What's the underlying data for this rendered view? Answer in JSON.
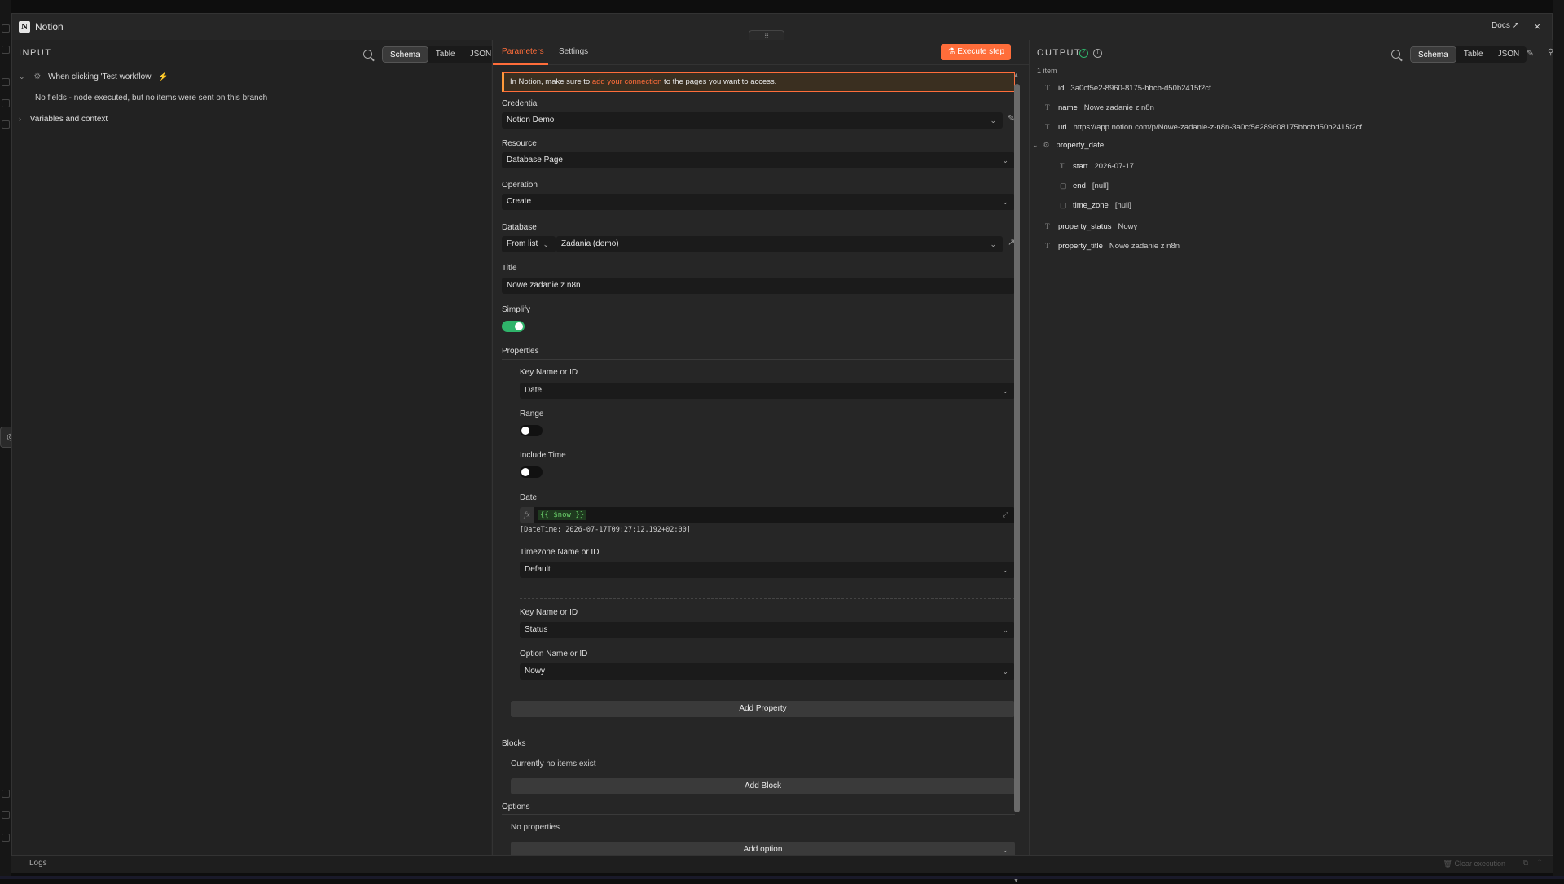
{
  "window": {
    "title": "Notion",
    "docs_label": "Docs ↗",
    "close_glyph": "×",
    "drag_glyph": "⠿"
  },
  "input": {
    "header": "INPUT",
    "view_tabs": [
      "Schema",
      "Table",
      "JSON"
    ],
    "trigger_label": "When clicking 'Test workflow'",
    "trigger_badge": "⚡",
    "no_fields_text": "No fields - node executed, but no items were sent on this branch",
    "variables_label": "Variables and context"
  },
  "params": {
    "tabs": [
      "Parameters",
      "Settings"
    ],
    "execute_label": "Execute step",
    "notice": {
      "prefix": "In Notion, make sure to ",
      "link": "add your connection",
      "suffix": " to the pages you want to access."
    },
    "credential": {
      "label": "Credential",
      "value": "Notion Demo"
    },
    "resource": {
      "label": "Resource",
      "value": "Database Page"
    },
    "operation": {
      "label": "Operation",
      "value": "Create"
    },
    "database": {
      "label": "Database",
      "mode": "From list",
      "value": "Zadania (demo)"
    },
    "title": {
      "label": "Title",
      "value": "Nowe zadanie z n8n"
    },
    "simplify": {
      "label": "Simplify",
      "on": true
    },
    "properties_label": "Properties",
    "property1": {
      "key_label": "Key Name or ID",
      "key_value": "Date",
      "range_label": "Range",
      "range_on": false,
      "include_time_label": "Include Time",
      "include_time_on": false,
      "date_label": "Date",
      "date_expr": "{{ $now }}",
      "fx": "fx",
      "date_hint": "[DateTime: 2026-07-17T09:27:12.192+02:00]",
      "tz_label": "Timezone Name or ID",
      "tz_value": "Default"
    },
    "property2": {
      "key_label": "Key Name or ID",
      "key_value": "Status",
      "option_label": "Option Name or ID",
      "option_value": "Nowy"
    },
    "add_property": "Add Property",
    "blocks": {
      "label": "Blocks",
      "empty": "Currently no items exist",
      "add": "Add Block"
    },
    "options": {
      "label": "Options",
      "empty": "No properties",
      "add": "Add option"
    }
  },
  "output": {
    "header": "OUTPUT",
    "count": "1 item",
    "view_tabs": [
      "Schema",
      "Table",
      "JSON"
    ],
    "fields": [
      {
        "type": "T",
        "key": "id",
        "value": "3a0cf5e2-8960-8175-bbcb-d50b2415f2cf"
      },
      {
        "type": "T",
        "key": "name",
        "value": "Nowe zadanie z n8n"
      },
      {
        "type": "T",
        "key": "url",
        "value": "https://app.notion.com/p/Nowe-zadanie-z-n8n-3a0cf5e289608175bbcbd50b2415f2cf"
      },
      {
        "type": "⚙",
        "key": "property_date",
        "value": ""
      },
      {
        "type": "T",
        "key": "start",
        "value": "2026-07-17"
      },
      {
        "type": "▢",
        "key": "end",
        "value": "[null]"
      },
      {
        "type": "▢",
        "key": "time_zone",
        "value": "[null]"
      },
      {
        "type": "T",
        "key": "property_status",
        "value": "Nowy"
      },
      {
        "type": "T",
        "key": "property_title",
        "value": "Nowe zadanie z n8n"
      }
    ]
  },
  "footer": {
    "logs": "Logs",
    "clear": "Clear execution"
  },
  "colors": {
    "accent": "#ff6d3a",
    "success": "#2fb36a"
  }
}
